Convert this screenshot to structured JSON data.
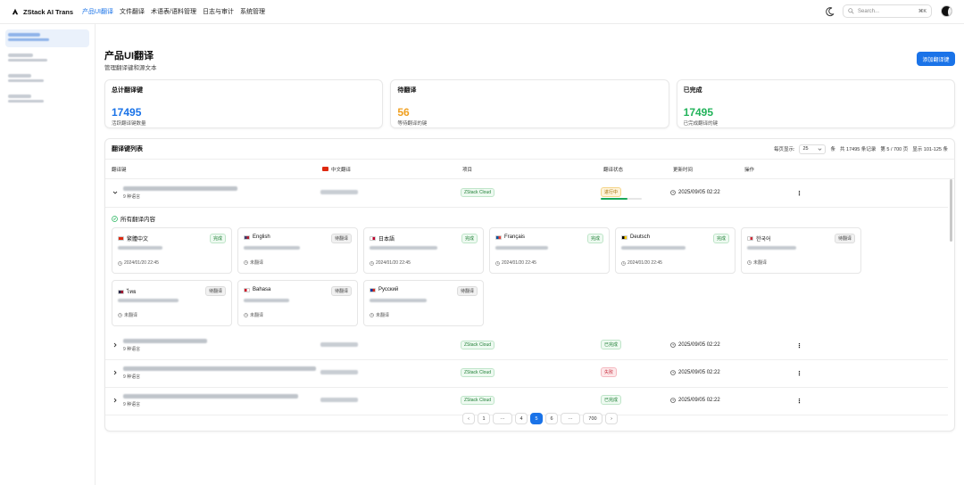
{
  "app": {
    "name": "ZStack AI Trans"
  },
  "nav": [
    {
      "label": "产品UI翻译",
      "active": true
    },
    {
      "label": "文件翻译"
    },
    {
      "label": "术语表/语料管理"
    },
    {
      "label": "日志与审计"
    },
    {
      "label": "系统管理"
    }
  ],
  "search": {
    "placeholder": "Search...",
    "shortcut": "⌘K"
  },
  "page": {
    "title": "产品UI翻译",
    "subtitle": "管理翻译键和源文本",
    "add_button": "添加翻译键"
  },
  "stats": [
    {
      "title": "总计翻译键",
      "value": "17495",
      "desc": "活跃翻译键数量",
      "color": "#1a73e8"
    },
    {
      "title": "待翻译",
      "value": "56",
      "desc": "等待翻译的键",
      "color": "#f0a020"
    },
    {
      "title": "已完成",
      "value": "17495",
      "desc": "已完成翻译的键",
      "color": "#22b35a"
    }
  ],
  "list": {
    "title": "翻译键列表",
    "per_page_label": "每页显示:",
    "per_page_value": "25",
    "per_page_unit": "条",
    "total": "共 17495 条记录",
    "page_info": "第 5 / 700 页",
    "range": "显示 101-125 条",
    "columns": [
      "翻译键",
      "中文翻译",
      "项目",
      "翻译状态",
      "更新时间",
      "操作"
    ]
  },
  "rows": [
    {
      "lang_count": "9 种语言",
      "project": "ZStack Cloud",
      "status": "进行中",
      "status_type": "progress",
      "progress": 0.65,
      "time": "2025/09/05 02:22",
      "expanded": true
    },
    {
      "lang_count": "9 种语言",
      "project": "ZStack Cloud",
      "status": "已完成",
      "status_type": "done",
      "time": "2025/09/05 02:22"
    },
    {
      "lang_count": "9 种语言",
      "project": "ZStack Cloud",
      "status": "失败",
      "status_type": "fail",
      "time": "2025/09/05 02:22"
    },
    {
      "lang_count": "9 种语言",
      "project": "ZStack Cloud",
      "status": "已完成",
      "status_type": "done",
      "time": "2025/09/05 02:22"
    }
  ],
  "expanded": {
    "title": "所有翻译内容",
    "translations": [
      {
        "lang": "繁體中文",
        "badge": "完成",
        "badge_type": "done",
        "meta": "2024/01/20 22:45",
        "flag": [
          "#de2910",
          "#de2910"
        ]
      },
      {
        "lang": "English",
        "badge": "待翻译",
        "badge_type": "pending",
        "meta": "未翻译",
        "flag": [
          "#3c3b6e",
          "#b22234"
        ]
      },
      {
        "lang": "日本語",
        "badge": "完成",
        "badge_type": "done",
        "meta": "2024/01/20 22:45",
        "flag": [
          "#ffffff",
          "#bc002d"
        ]
      },
      {
        "lang": "Français",
        "badge": "完成",
        "badge_type": "done",
        "meta": "2024/01/20 22:45",
        "flag": [
          "#0055a4",
          "#ef4135"
        ]
      },
      {
        "lang": "Deutsch",
        "badge": "完成",
        "badge_type": "done",
        "meta": "2024/01/20 22:45",
        "flag": [
          "#000000",
          "#ffce00"
        ]
      },
      {
        "lang": "한국어",
        "badge": "待翻译",
        "badge_type": "pending",
        "meta": "未翻译",
        "flag": [
          "#ffffff",
          "#cd2e3a"
        ]
      },
      {
        "lang": "ไทย",
        "badge": "待翻译",
        "badge_type": "pending",
        "meta": "未翻译",
        "flag": [
          "#2d2a4a",
          "#a51931"
        ]
      },
      {
        "lang": "Bahasa",
        "badge": "待翻译",
        "badge_type": "pending",
        "meta": "未翻译",
        "flag": [
          "#ce1126",
          "#ffffff"
        ]
      },
      {
        "lang": "Русский",
        "badge": "待翻译",
        "badge_type": "pending",
        "meta": "未翻译",
        "flag": [
          "#0039a6",
          "#d52b1e"
        ]
      }
    ]
  },
  "pager": [
    "‹",
    "1",
    "···",
    "4",
    "5",
    "6",
    "···",
    "700",
    "›"
  ],
  "pager_active": "5"
}
